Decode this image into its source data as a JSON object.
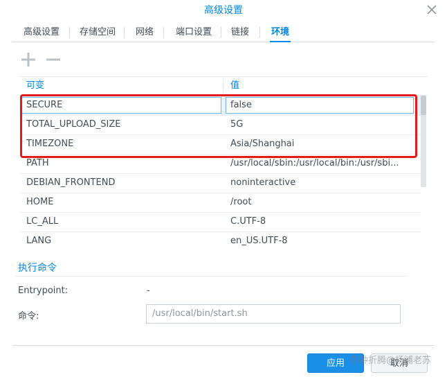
{
  "window": {
    "title": "高级设置"
  },
  "tabs": [
    {
      "label": "高级设置",
      "active": false
    },
    {
      "label": "存储空间",
      "active": false
    },
    {
      "label": "网络",
      "active": false
    },
    {
      "label": "端口设置",
      "active": false
    },
    {
      "label": "链接",
      "active": false
    },
    {
      "label": "环境",
      "active": true
    }
  ],
  "toolbar": {
    "add_icon": "plus-icon",
    "remove_icon": "minus-icon"
  },
  "env_table": {
    "columns": [
      "可变",
      "值"
    ],
    "rows": [
      {
        "key": "SECURE",
        "value": "false"
      },
      {
        "key": "TOTAL_UPLOAD_SIZE",
        "value": "5G"
      },
      {
        "key": "TIMEZONE",
        "value": "Asia/Shanghai"
      },
      {
        "key": "PATH",
        "value": "/usr/local/sbin:/usr/local/bin:/usr/sbi..."
      },
      {
        "key": "DEBIAN_FRONTEND",
        "value": "noninteractive"
      },
      {
        "key": "HOME",
        "value": "/root"
      },
      {
        "key": "LC_ALL",
        "value": "C.UTF-8"
      },
      {
        "key": "LANG",
        "value": "en_US.UTF-8"
      }
    ]
  },
  "exec": {
    "section_title": "执行命令",
    "entrypoint_label": "Entrypoint:",
    "entrypoint_value": "-",
    "command_label": "命令:",
    "command_placeholder": "/usr/local/bin/start.sh"
  },
  "footer": {
    "apply_label": "应用",
    "cancel_label": "取消"
  },
  "watermark": "各种折腾@杨浦老苏",
  "colors": {
    "accent": "#0086e5",
    "highlight": "#e21a1a"
  }
}
